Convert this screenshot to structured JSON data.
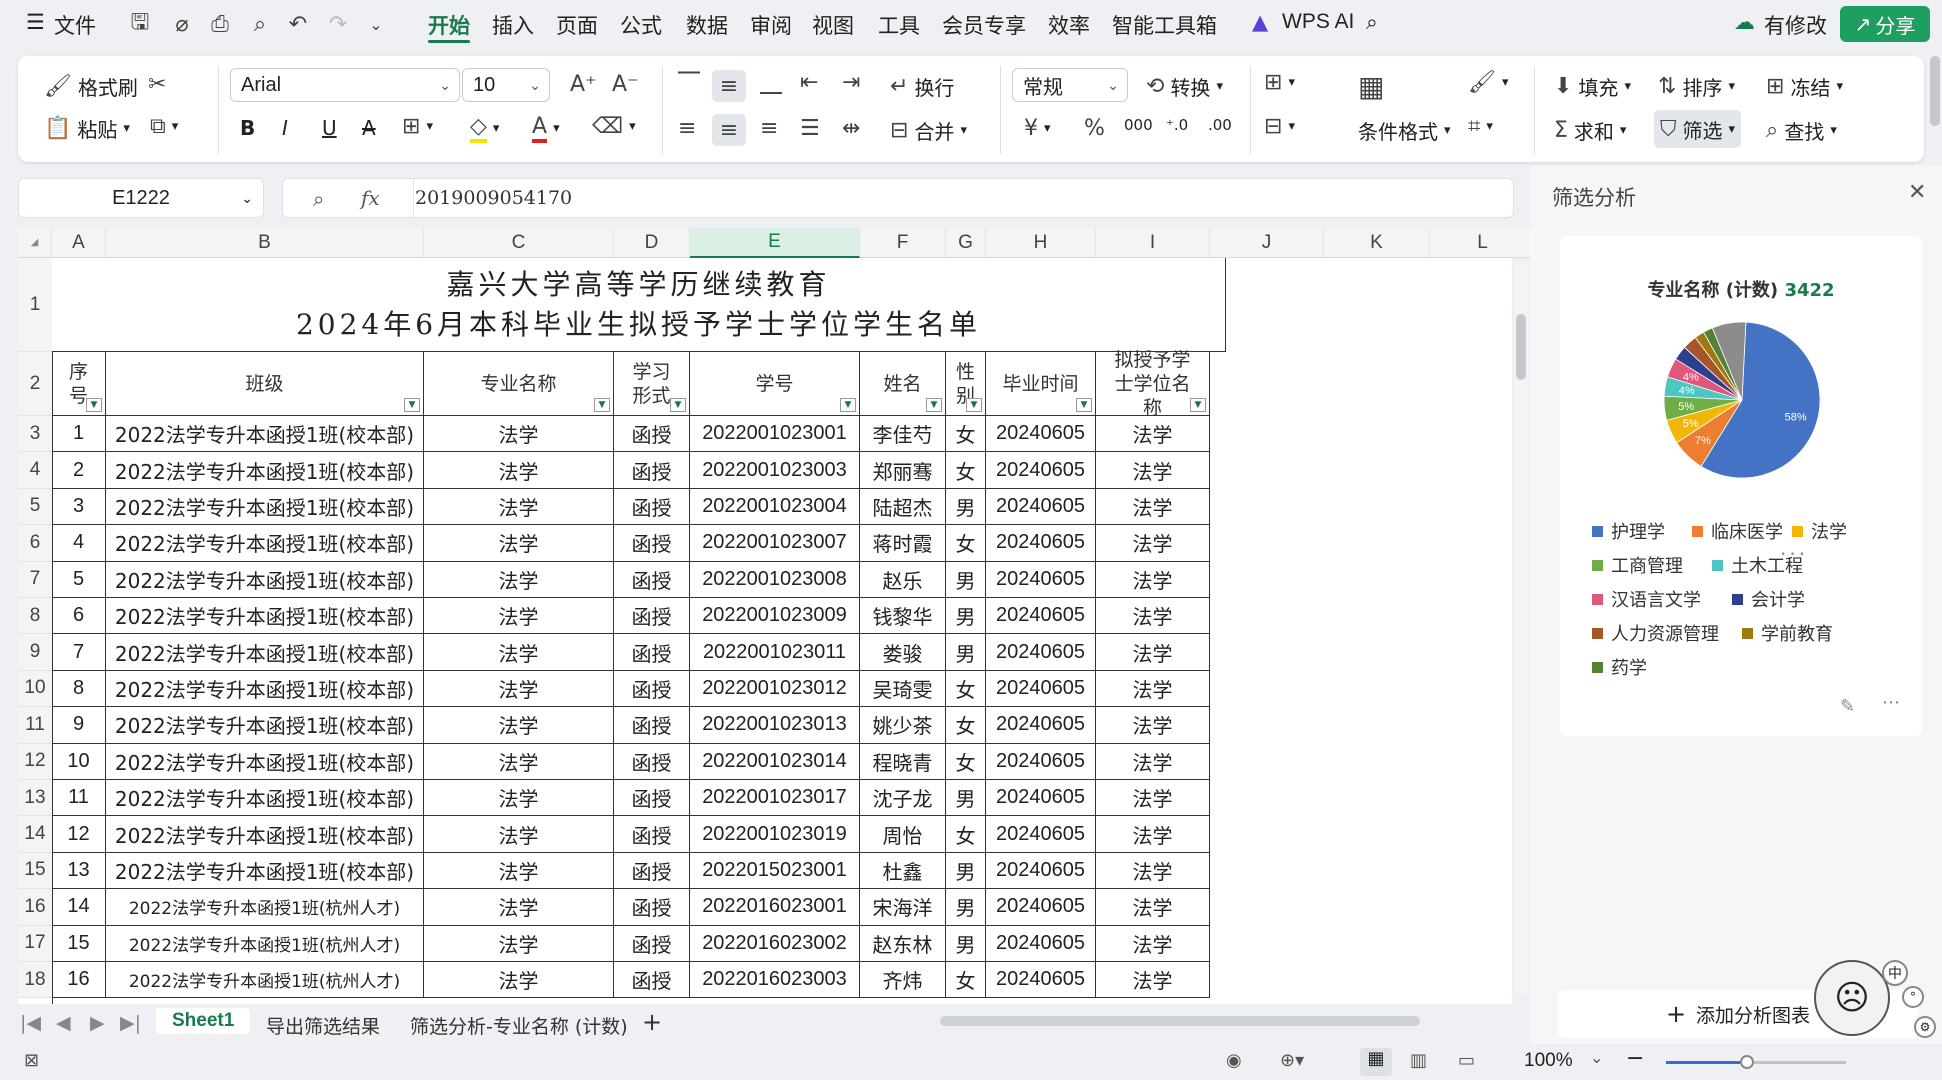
{
  "menu": {
    "file": "文件",
    "tabs": [
      "开始",
      "插入",
      "页面",
      "公式",
      "数据",
      "审阅",
      "视图",
      "工具",
      "会员专享",
      "效率",
      "智能工具箱"
    ],
    "wps_ai": "WPS AI",
    "modified": "有修改",
    "share": "分享"
  },
  "ribbon": {
    "format_painter": "格式刷",
    "paste": "粘贴",
    "font_name": "Arial",
    "font_size": "10",
    "wrap": "换行",
    "merge": "合并",
    "number_format": "常规",
    "convert": "转换",
    "cond_format": "条件格式",
    "fill": "填充",
    "sort": "排序",
    "freeze": "冻结",
    "sum": "求和",
    "filter": "筛选",
    "find": "查找"
  },
  "formula": {
    "cell_ref": "E1222",
    "fx": "fx",
    "value": "2019009054170"
  },
  "columns": [
    "A",
    "B",
    "C",
    "D",
    "E",
    "F",
    "G",
    "H",
    "I",
    "J",
    "K",
    "L"
  ],
  "sheet_title_1": "嘉兴大学高等学历继续教育",
  "sheet_title_2": "2024年6月本科毕业生拟授予学士学位学生名单",
  "headers": [
    "序号",
    "班级",
    "专业名称",
    "学习形式",
    "学号",
    "姓名",
    "性别",
    "毕业时间",
    "拟授予学士学位名称"
  ],
  "row_numbers": [
    "1",
    "2",
    "3",
    "4",
    "5",
    "6",
    "7",
    "8",
    "9",
    "10",
    "11",
    "12",
    "13",
    "14",
    "15",
    "16",
    "17",
    "18"
  ],
  "rows": [
    [
      "1",
      "2022法学专升本函授1班(校本部)",
      "法学",
      "函授",
      "2022001023001",
      "李佳芍",
      "女",
      "20240605",
      "法学"
    ],
    [
      "2",
      "2022法学专升本函授1班(校本部)",
      "法学",
      "函授",
      "2022001023003",
      "郑丽骞",
      "女",
      "20240605",
      "法学"
    ],
    [
      "3",
      "2022法学专升本函授1班(校本部)",
      "法学",
      "函授",
      "2022001023004",
      "陆超杰",
      "男",
      "20240605",
      "法学"
    ],
    [
      "4",
      "2022法学专升本函授1班(校本部)",
      "法学",
      "函授",
      "2022001023007",
      "蒋时霞",
      "女",
      "20240605",
      "法学"
    ],
    [
      "5",
      "2022法学专升本函授1班(校本部)",
      "法学",
      "函授",
      "2022001023008",
      "赵乐",
      "男",
      "20240605",
      "法学"
    ],
    [
      "6",
      "2022法学专升本函授1班(校本部)",
      "法学",
      "函授",
      "2022001023009",
      "钱黎华",
      "男",
      "20240605",
      "法学"
    ],
    [
      "7",
      "2022法学专升本函授1班(校本部)",
      "法学",
      "函授",
      "2022001023011",
      "娄骏",
      "男",
      "20240605",
      "法学"
    ],
    [
      "8",
      "2022法学专升本函授1班(校本部)",
      "法学",
      "函授",
      "2022001023012",
      "吴琦雯",
      "女",
      "20240605",
      "法学"
    ],
    [
      "9",
      "2022法学专升本函授1班(校本部)",
      "法学",
      "函授",
      "2022001023013",
      "姚少茶",
      "女",
      "20240605",
      "法学"
    ],
    [
      "10",
      "2022法学专升本函授1班(校本部)",
      "法学",
      "函授",
      "2022001023014",
      "程晓青",
      "女",
      "20240605",
      "法学"
    ],
    [
      "11",
      "2022法学专升本函授1班(校本部)",
      "法学",
      "函授",
      "2022001023017",
      "沈子龙",
      "男",
      "20240605",
      "法学"
    ],
    [
      "12",
      "2022法学专升本函授1班(校本部)",
      "法学",
      "函授",
      "2022001023019",
      "周怡",
      "女",
      "20240605",
      "法学"
    ],
    [
      "13",
      "2022法学专升本函授1班(校本部)",
      "法学",
      "函授",
      "2022015023001",
      "杜鑫",
      "男",
      "20240605",
      "法学"
    ],
    [
      "14",
      "2022法学专升本函授1班(杭州人才)",
      "法学",
      "函授",
      "2022016023001",
      "宋海洋",
      "男",
      "20240605",
      "法学"
    ],
    [
      "15",
      "2022法学专升本函授1班(杭州人才)",
      "法学",
      "函授",
      "2022016023002",
      "赵东林",
      "男",
      "20240605",
      "法学"
    ],
    [
      "16",
      "2022法学专升本函授1班(杭州人才)",
      "法学",
      "函授",
      "2022016023003",
      "齐炜",
      "女",
      "20240605",
      "法学"
    ]
  ],
  "sheet_tabs": [
    "Sheet1",
    "导出筛选结果",
    "筛选分析-专业名称 (计数)"
  ],
  "status": {
    "zoom": "100%"
  },
  "panel": {
    "title": "筛选分析",
    "chart_title": "专业名称 (计数)",
    "chart_count": "3422",
    "add_chart": "添加分析图表",
    "more": "..."
  },
  "chart_data": {
    "type": "pie",
    "title": "专业名称 (计数) 3422",
    "labels": [
      "护理学",
      "临床医学",
      "法学",
      "工商管理",
      "土木工程",
      "汉语言文学",
      "会计学",
      "人力资源管理",
      "学前教育",
      "药学"
    ],
    "slice_labels": [
      "58%",
      "7%",
      "5%",
      "5%",
      "4%",
      "4%"
    ],
    "values": [
      58,
      7,
      5,
      5,
      4,
      4,
      3,
      3,
      2,
      2,
      7
    ],
    "colors": [
      "#4472c4",
      "#ed7d31",
      "#f2b705",
      "#70ad47",
      "#4bc6c0",
      "#e2567a",
      "#2f3f8f",
      "#a65628",
      "#9c7a0f",
      "#548235",
      "#8c8c8c"
    ],
    "legend": "bottom"
  }
}
